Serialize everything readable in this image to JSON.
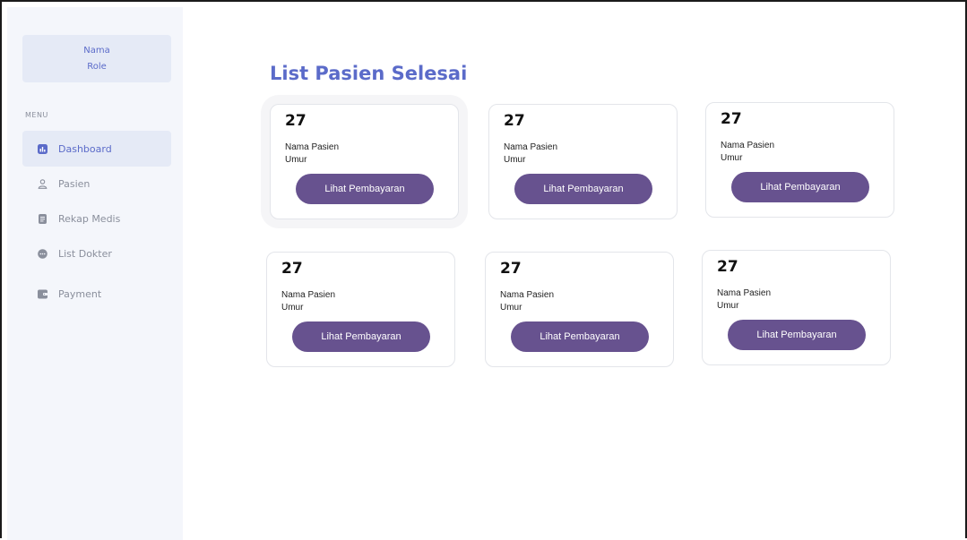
{
  "user": {
    "name": "Nama",
    "role": "Role"
  },
  "sidebar": {
    "menu_label": "MENU",
    "items": [
      {
        "label": "Dashboard",
        "icon": "chart-icon",
        "active": true
      },
      {
        "label": "Pasien",
        "icon": "user-icon",
        "active": false
      },
      {
        "label": "Rekap Medis",
        "icon": "document-icon",
        "active": false
      },
      {
        "label": "List Dokter",
        "icon": "chat-icon",
        "active": false
      },
      {
        "label": "Payment",
        "icon": "wallet-icon",
        "active": false
      }
    ]
  },
  "main": {
    "title": "List Pasien Selesai",
    "cards": [
      {
        "number": "27",
        "name_label": "Nama Pasien",
        "age_label": "Umur",
        "button_label": "Lihat Pembayaran"
      },
      {
        "number": "27",
        "name_label": "Nama Pasien",
        "age_label": "Umur",
        "button_label": "Lihat Pembayaran"
      },
      {
        "number": "27",
        "name_label": "Nama Pasien",
        "age_label": "Umur",
        "button_label": "Lihat Pembayaran"
      },
      {
        "number": "27",
        "name_label": "Nama Pasien",
        "age_label": "Umur",
        "button_label": "Lihat Pembayaran"
      },
      {
        "number": "27",
        "name_label": "Nama Pasien",
        "age_label": "Umur",
        "button_label": "Lihat Pembayaran"
      },
      {
        "number": "27",
        "name_label": "Nama Pasien",
        "age_label": "Umur",
        "button_label": "Lihat Pembayaran"
      }
    ]
  },
  "colors": {
    "accent": "#5b6bc9",
    "button": "#67528f",
    "sidebar_bg": "#f4f6fb",
    "active_bg": "#e5eaf6"
  }
}
